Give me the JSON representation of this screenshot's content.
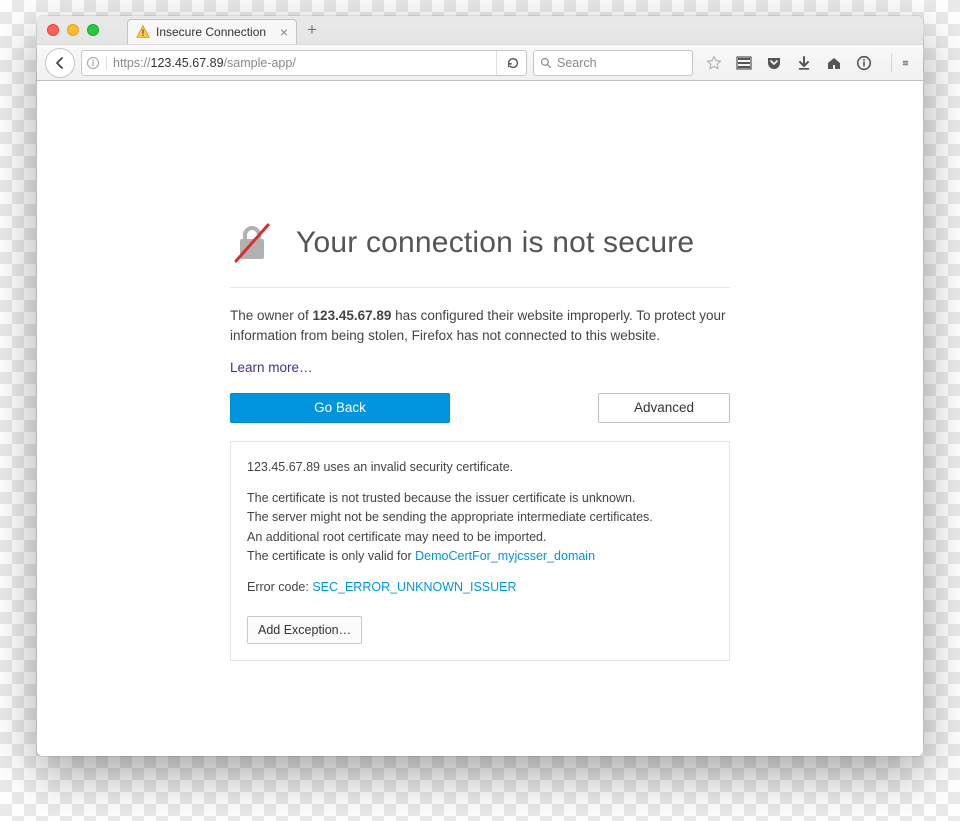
{
  "tab": {
    "title": "Insecure Connection"
  },
  "url": {
    "scheme": "https://",
    "host": "123.45.67.89",
    "path": "/sample-app/"
  },
  "search": {
    "placeholder": "Search"
  },
  "page": {
    "title": "Your connection is not secure",
    "desc_pre": "The owner of ",
    "desc_host": "123.45.67.89",
    "desc_post": " has configured their website improperly. To protect your information from being stolen, Firefox has not connected to this website.",
    "learn_more": "Learn more…",
    "go_back": "Go Back",
    "advanced": "Advanced",
    "details_line1": "123.45.67.89 uses an invalid security certificate.",
    "details_line2": "The certificate is not trusted because the issuer certificate is unknown.",
    "details_line3": "The server might not be sending the appropriate intermediate certificates.",
    "details_line4": "An additional root certificate may need to be imported.",
    "details_line5_pre": "The certificate is only valid for ",
    "details_cert_name": "DemoCertFor_myjcsser_domain",
    "error_code_label": "Error code: ",
    "error_code": "SEC_ERROR_UNKNOWN_ISSUER",
    "add_exception": "Add Exception…"
  }
}
